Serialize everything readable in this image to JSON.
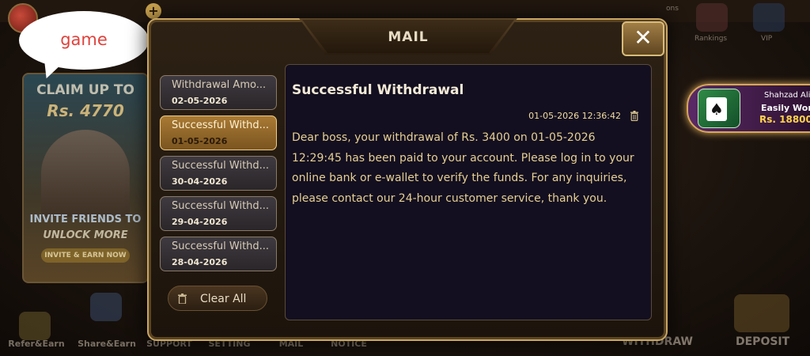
{
  "background": {
    "promo": {
      "title": "CLAIM UP TO",
      "amount": "Rs. 4770",
      "invite": "INVITE FRIENDS TO",
      "unlock": "UNLOCK MORE",
      "button": "INVITE & EARN NOW"
    },
    "bubble_text": "game",
    "top_right": [
      "ons",
      "Rankings",
      "VIP"
    ],
    "bottom_nav": [
      "Refer&Earn",
      "Share&Earn",
      "SUPPORT",
      "SETTING",
      "MAIL",
      "NOTICE"
    ],
    "withdraw_label": "WITHDRAW",
    "deposit_label": "DEPOSIT",
    "winner": {
      "name": "Shahzad Ali",
      "line": "Easily Won",
      "amount": "Rs. 18800"
    }
  },
  "modal": {
    "title": "MAIL",
    "close_icon": "close-icon",
    "mail_items": [
      {
        "title": "Withdrawal Amo...",
        "date": "02-05-2026",
        "active": false
      },
      {
        "title": "Successful Withd...",
        "date": "01-05-2026",
        "active": true
      },
      {
        "title": "Successful Withd...",
        "date": "30-04-2026",
        "active": false
      },
      {
        "title": "Successful Withd...",
        "date": "29-04-2026",
        "active": false
      },
      {
        "title": "Successful Withd...",
        "date": "28-04-2026",
        "active": false
      }
    ],
    "clear_all_label": "Clear All",
    "content": {
      "title": "Successful Withdrawal",
      "timestamp": "01-05-2026 12:36:42",
      "body": "Dear boss, your withdrawal of Rs. 3400 on 01-05-2026 12:29:45 has been paid to your account. Please log in to your online bank or e-wallet to verify the funds. For any inquiries, please contact our 24-hour customer service, thank you."
    }
  },
  "colors": {
    "accent_gold": "#c8a664",
    "active_tab": "#a97a34",
    "content_bg": "#130f20",
    "body_text": "#e6cf92"
  }
}
